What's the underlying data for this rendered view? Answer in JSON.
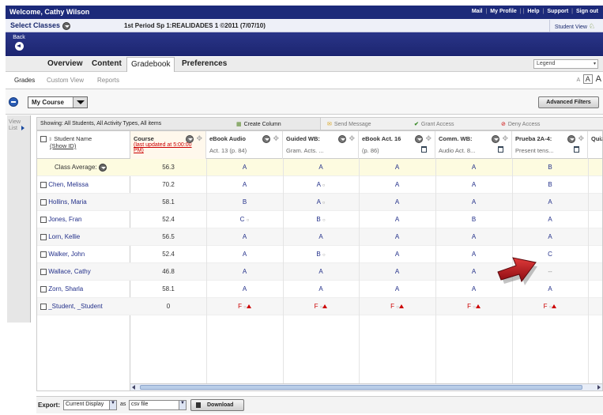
{
  "topbar": {
    "welcome": "Welcome, Cathy Wilson",
    "links": [
      "Mail",
      "My Profile",
      "Help",
      "Support",
      "Sign out"
    ]
  },
  "classbar": {
    "select_label": "Select Classes",
    "course_title": "1st Period Sp 1:REALIDADES 1 ©2011 (7/07/10)",
    "student_view": "Student View"
  },
  "back_label": "Back",
  "tabs": [
    "Overview",
    "Content",
    "Gradebook",
    "Preferences"
  ],
  "active_tab": "Gradebook",
  "legend_placeholder": "Legend",
  "subtabs": [
    "Grades",
    "Custom View",
    "Reports"
  ],
  "font_sizes": [
    "A",
    "A",
    "A"
  ],
  "my_course": "My Course",
  "advanced_filters": "Advanced Filters",
  "view_list": "View List",
  "showing_text": "Showing: All Students, All Activity Types, All items",
  "actions": {
    "create_column": "Create Column",
    "send_message": "Send Message",
    "grant_access": "Grant Access",
    "deny_access": "Deny Access"
  },
  "grid": {
    "name_header": "Student Name",
    "show_id": "(Show ID)",
    "course_header": "Course",
    "course_updated": "(last updated at 5:00:00 PM)",
    "columns": [
      {
        "title": "eBook Audio",
        "sub": "Act. 13 (p. 84)"
      },
      {
        "title": "Guided WB:",
        "sub": "Gram. Acts. ..."
      },
      {
        "title": "eBook Act. 16",
        "sub": "(p. 86)"
      },
      {
        "title": "Comm. WB:",
        "sub": "Audio Act. 8..."
      },
      {
        "title": "Prueba 2A-4:",
        "sub": "Present tens..."
      },
      {
        "title": "Quiz",
        "sub": ""
      }
    ],
    "class_average_label": "Class Average:",
    "class_average": [
      "56.3",
      "A",
      "A",
      "A",
      "A",
      "B"
    ],
    "students": [
      {
        "name": "Chen, Melissa",
        "course": "70.2",
        "grades": [
          "A",
          "A",
          "A",
          "A",
          "B"
        ]
      },
      {
        "name": "Hollins, Maria",
        "course": "58.1",
        "grades": [
          "B",
          "A",
          "A",
          "A",
          "A"
        ]
      },
      {
        "name": "Jones, Fran",
        "course": "52.4",
        "grades": [
          "C",
          "B",
          "A",
          "B",
          "A"
        ]
      },
      {
        "name": "Lorn, Kellie",
        "course": "56.5",
        "grades": [
          "A",
          "A",
          "A",
          "A",
          "A"
        ]
      },
      {
        "name": "Walker, John",
        "course": "52.4",
        "grades": [
          "A",
          "B",
          "A",
          "A",
          "C"
        ]
      },
      {
        "name": "Wallace, Cathy",
        "course": "46.8",
        "grades": [
          "A",
          "A",
          "A",
          "A",
          "--"
        ]
      },
      {
        "name": "Zorn, Sharla",
        "course": "58.1",
        "grades": [
          "A",
          "A",
          "A",
          "A",
          "A"
        ]
      },
      {
        "name": "_Student, _Student",
        "course": "0",
        "grades": [
          "F",
          "F",
          "F",
          "F",
          "F"
        ]
      }
    ]
  },
  "export": {
    "label": "Export:",
    "display": "Current Display",
    "as": "as",
    "format": "csv file",
    "download": "Download"
  },
  "colors": {
    "topbar": "#1c2a7a",
    "grade_text": "#23308a",
    "fail": "#cc0000",
    "arrow": "#b0121b"
  }
}
